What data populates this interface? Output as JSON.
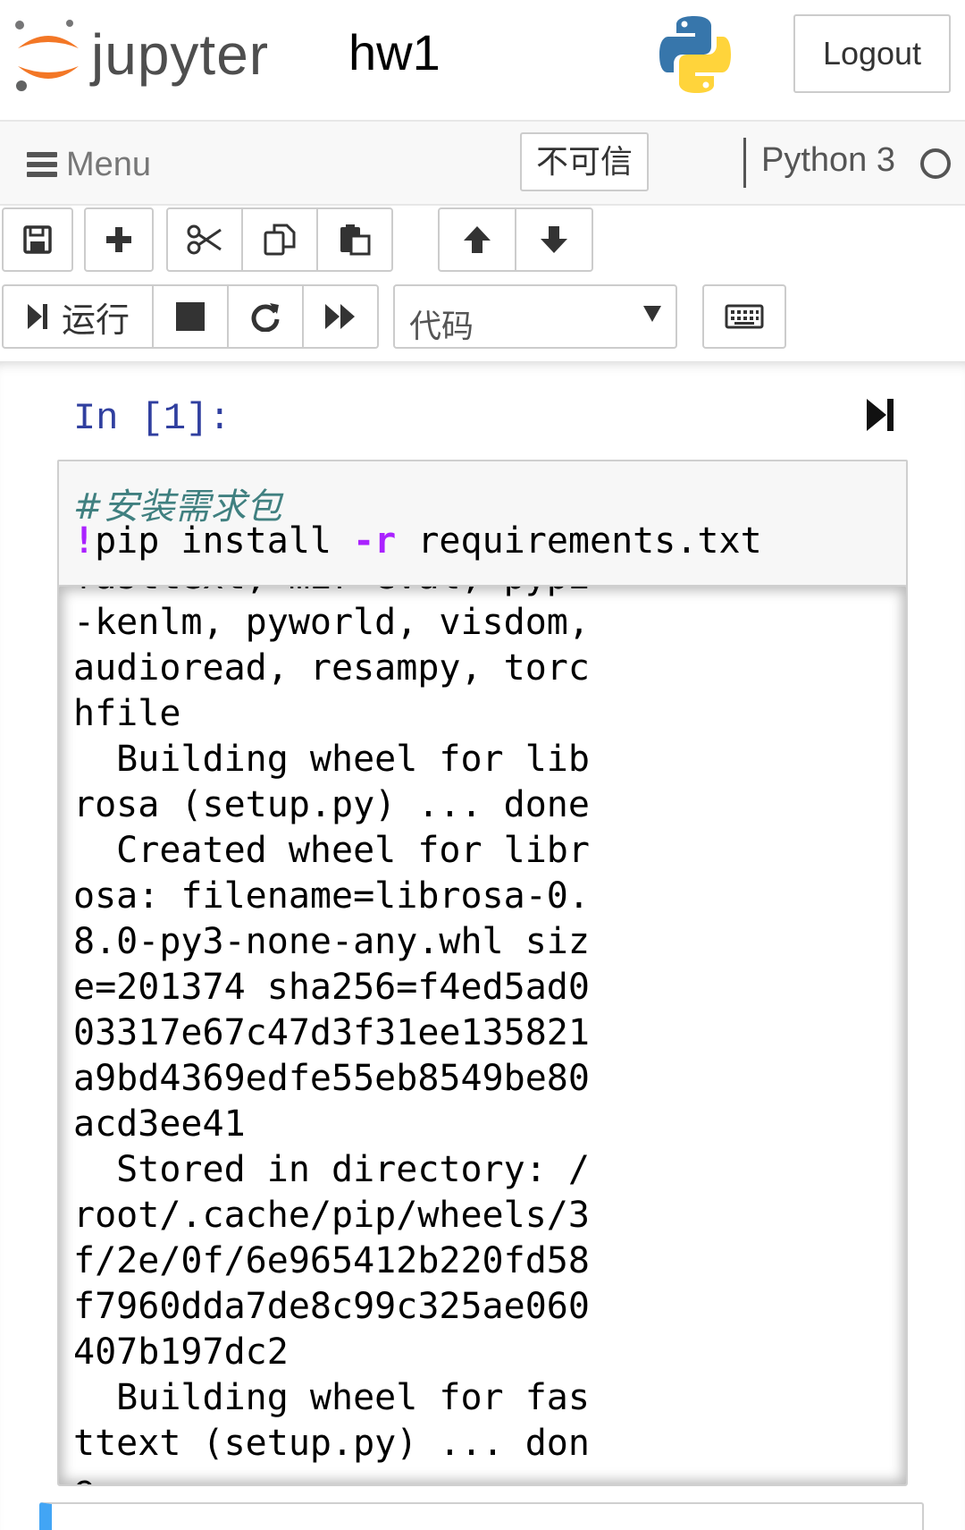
{
  "header": {
    "brand": "jupyter",
    "notebook_name": "hw1",
    "logout_label": "Logout"
  },
  "menubar": {
    "menu_label": "Menu",
    "trust_label": "不可信",
    "kernel_name": "Python 3"
  },
  "toolbar": {
    "run_label": "运行",
    "cell_type": "代码",
    "icons": [
      "save-icon",
      "plus-icon",
      "scissors-icon",
      "copy-icon",
      "paste-icon",
      "arrow-up-icon",
      "arrow-down-icon",
      "step-forward-icon",
      "stop-icon",
      "restart-icon",
      "fast-forward-icon",
      "keyboard-icon"
    ]
  },
  "cell": {
    "prompt": "In [1]:",
    "code_comment": "#安装需求包",
    "code_bang": "!",
    "code_cmd1": "pip install ",
    "code_flag": "-r",
    "code_cmd2": " requirements.txt",
    "output_lines": [
      "fasttext, mir-eval, pypi",
      "-kenlm, pyworld, visdom,",
      "audioread, resampy, torc",
      "hfile",
      "  Building wheel for lib",
      "rosa (setup.py) ... done",
      "  Created wheel for libr",
      "osa: filename=librosa-0.",
      "8.0-py3-none-any.whl siz",
      "e=201374 sha256=f4ed5ad0",
      "03317e67c47d3f31ee135821",
      "a9bd4369edfe55eb8549be80",
      "acd3ee41",
      "  Stored in directory: /",
      "root/.cache/pip/wheels/3",
      "f/2e/0f/6e965412b220fd58",
      "f7960dda7de8c99c325ae060",
      "407b197dc2",
      "  Building wheel for fas",
      "ttext (setup.py) ... don",
      "e"
    ]
  },
  "colors": {
    "prompt": "#303f9f",
    "comment": "#408080",
    "magic": "#aa22ff",
    "selected_cell": "#42a5f5",
    "jupyter_orange": "#f37726"
  }
}
